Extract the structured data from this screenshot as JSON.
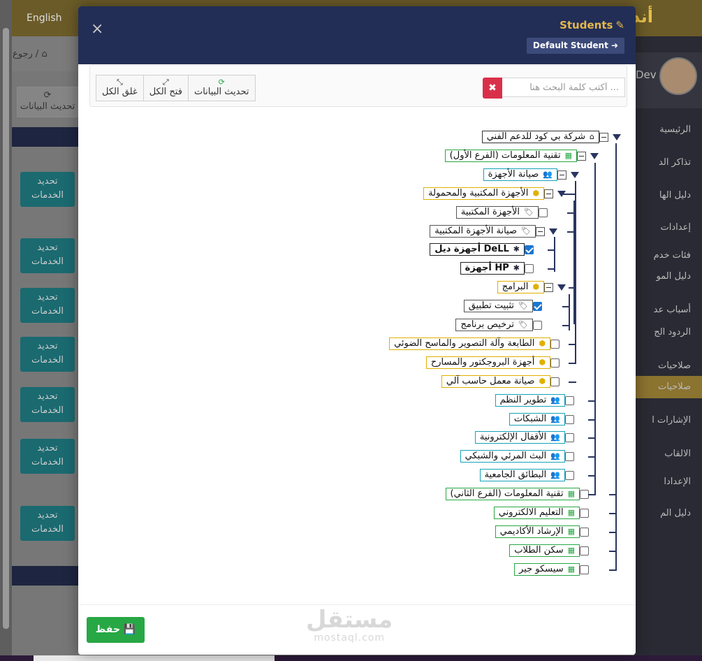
{
  "background": {
    "language_link": "English",
    "app_title": "أند",
    "breadcrumb": "رجوع / ",
    "refresh_label": "تحديث البيانات",
    "side_buttons": [
      "تحديد الخدمات",
      "تحديد الخدمات",
      "تحديد الخدمات",
      "تحديد الخدمات",
      "تحديد الخدمات",
      "تحديد الخدمات",
      "تحديد الخدمات"
    ],
    "user_name": "Dev",
    "sidebar_items": [
      "الرئيسية",
      "تذاكر الد",
      "دليل الها",
      "إعدادات",
      "فئات خدم",
      "دليل المو",
      "أسباب عد",
      "الردود الج",
      "صلاحيات",
      "صلاحيات",
      "الإشارات ا",
      "الالقاب",
      "الإعدادا",
      "دليل الم"
    ]
  },
  "modal": {
    "title": "Students",
    "default_student_label": "Default Student",
    "close_icon": "×",
    "toolbar": {
      "refresh": "تحديث البيانات",
      "expand_all": "فتح الكل",
      "collapse_all": "غلق الكل"
    },
    "search": {
      "placeholder": "أكتب كلمة البحث هنا ...",
      "value": ""
    },
    "save_label": "حفظ",
    "watermark_big": "مستقل",
    "watermark_small": "mostaql.com",
    "colors": {
      "header": "#222e55",
      "accent": "#e6b84c",
      "save": "#28a745",
      "clear": "#d9304a"
    }
  },
  "tree": [
    {
      "label": "شركة بي كود للدعم الفني",
      "type": "company",
      "icon": "home-icon",
      "control": "minus",
      "arrow": true
    },
    {
      "label": "تقنية المعلومات (الفرع الأول)",
      "type": "branch",
      "icon": "building-icon",
      "control": "minus",
      "arrow": true
    },
    {
      "label": "صيانة الأجهزة",
      "type": "dept",
      "icon": "users-icon",
      "control": "minus",
      "arrow": true
    },
    {
      "label": "الأجهزة المكتبية والمحمولة",
      "type": "cat",
      "icon": "cube-icon",
      "control": "minus",
      "arrow": true
    },
    {
      "label": "الأجهزة المكتبية",
      "type": "sub",
      "icon": "tag-icon",
      "control": "checkbox",
      "checked": false
    },
    {
      "label": "صيانة الأجهزة المكتبية",
      "type": "sub",
      "icon": "tag-icon",
      "control": "minus",
      "arrow": true
    },
    {
      "label": "أجهزة ديل DeLL",
      "type": "item",
      "icon": "asterisk-icon",
      "control": "checkbox",
      "checked": true
    },
    {
      "label": "أجهزة HP",
      "type": "item",
      "icon": "asterisk-icon",
      "control": "checkbox",
      "checked": false
    },
    {
      "label": "البرامج",
      "type": "cat",
      "icon": "cube-icon",
      "control": "minus",
      "arrow": true
    },
    {
      "label": "تثبيت تطبيق",
      "type": "sub",
      "icon": "tag-icon",
      "control": "checkbox",
      "checked": true
    },
    {
      "label": "ترخيص برنامج",
      "type": "sub",
      "icon": "tag-icon",
      "control": "checkbox",
      "checked": false
    },
    {
      "label": "الطابعة وآلة التصوير والماسح الضوئي",
      "type": "cat",
      "icon": "cube-icon",
      "control": "checkbox",
      "checked": false
    },
    {
      "label": "أجهزة البروجكتور والمسارح",
      "type": "cat",
      "icon": "cube-icon",
      "control": "checkbox",
      "checked": false
    },
    {
      "label": "صيانة معمل حاسب آلي",
      "type": "cat",
      "icon": "cube-icon",
      "control": "checkbox",
      "checked": false
    },
    {
      "label": "تطوير النظم",
      "type": "dept",
      "icon": "users-icon",
      "control": "checkbox",
      "checked": false
    },
    {
      "label": "الشبكات",
      "type": "dept",
      "icon": "users-icon",
      "control": "checkbox",
      "checked": false
    },
    {
      "label": "الأقفال الإلكترونية",
      "type": "dept",
      "icon": "users-icon",
      "control": "checkbox",
      "checked": false
    },
    {
      "label": "البث المرئي والشبكي",
      "type": "dept",
      "icon": "users-icon",
      "control": "checkbox",
      "checked": false
    },
    {
      "label": "البطائق الجامعية",
      "type": "dept",
      "icon": "users-icon",
      "control": "checkbox",
      "checked": false
    },
    {
      "label": "تقنية المعلومات (الفرع الثاني)",
      "type": "branch",
      "icon": "building-icon",
      "control": "checkbox",
      "checked": false
    },
    {
      "label": "التعليم الالكتروني",
      "type": "branch",
      "icon": "building-icon",
      "control": "checkbox",
      "checked": false
    },
    {
      "label": "الإرشاد الأكاديمي",
      "type": "branch",
      "icon": "building-icon",
      "control": "checkbox",
      "checked": false
    },
    {
      "label": "سكن الطلاب",
      "type": "branch",
      "icon": "building-icon",
      "control": "checkbox",
      "checked": false
    },
    {
      "label": "سيسكو جير",
      "type": "branch",
      "icon": "building-icon",
      "control": "checkbox",
      "checked": false
    }
  ]
}
